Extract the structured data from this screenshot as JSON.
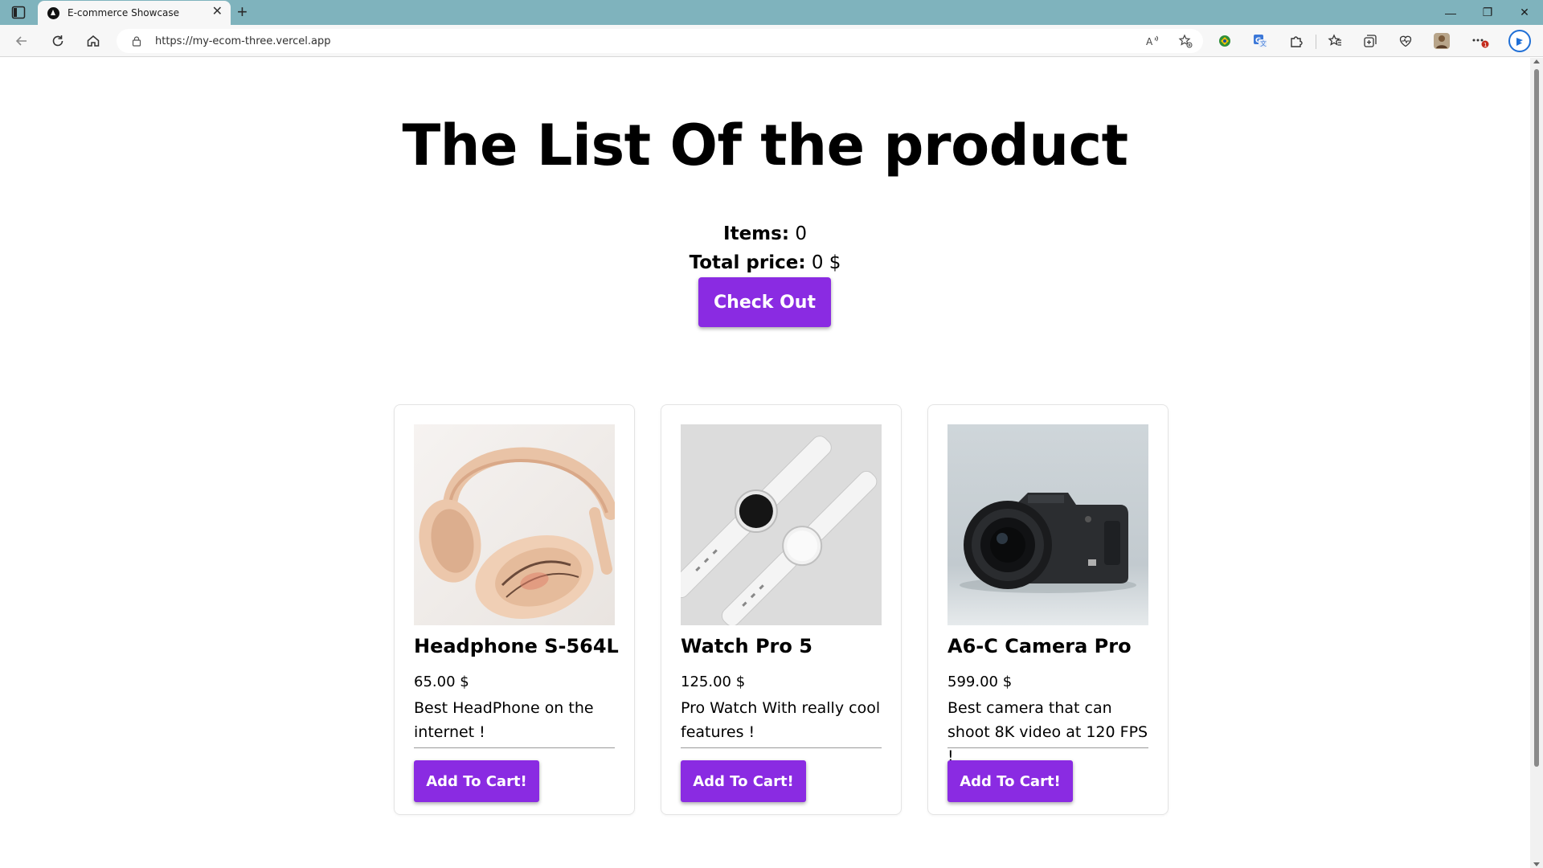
{
  "browser": {
    "tab_title": "E-commerce Showcase",
    "tab_close": "✕",
    "new_tab": "+",
    "url": "https://my-ecom-three.vercel.app",
    "window_controls": {
      "minimize": "—",
      "restore": "❐",
      "close": "✕"
    },
    "toolbar_icons": [
      "back-icon",
      "refresh-icon",
      "home-icon",
      "read-aloud-icon",
      "add-favorite-icon",
      "extension-icon",
      "translate-icon",
      "extensions-icon",
      "favorites-icon",
      "collections-icon",
      "browser-essentials-icon",
      "profile-icon",
      "more-icon",
      "bing-copilot-icon"
    ],
    "more_badge": "1",
    "accent": "#7fb3bd"
  },
  "page": {
    "title": "The List Of the product",
    "cart": {
      "items_label": "Items:",
      "items_value": "0",
      "total_label": "Total price:",
      "total_value": "0 $"
    },
    "checkout_label": "Check Out",
    "button_color": "#8a2be2"
  },
  "products": [
    {
      "name": "Headphone S-564L",
      "price": "65.00 $",
      "description": "Best HeadPhone on the internet !",
      "button": "Add To Cart!",
      "image": "headphones-image"
    },
    {
      "name": "Watch Pro 5",
      "price": "125.00 $",
      "description": "Pro Watch With really cool features !",
      "button": "Add To Cart!",
      "image": "watch-image"
    },
    {
      "name": "A6-C Camera Pro",
      "price": "599.00 $",
      "description": "Best camera that can shoot 8K video at 120 FPS !",
      "button": "Add To Cart!",
      "image": "camera-image"
    }
  ]
}
